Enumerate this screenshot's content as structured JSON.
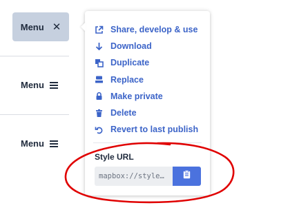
{
  "left_menus": [
    {
      "label": "Menu",
      "state": "open",
      "toggle_icon": "close-icon"
    },
    {
      "label": "Menu",
      "state": "closed",
      "toggle_icon": "hamburger-icon"
    },
    {
      "label": "Menu",
      "state": "closed",
      "toggle_icon": "hamburger-icon"
    }
  ],
  "dropdown": {
    "items": [
      {
        "label": "Share, develop & use",
        "icon": "external-link-icon"
      },
      {
        "label": "Download",
        "icon": "download-arrow-icon"
      },
      {
        "label": "Duplicate",
        "icon": "duplicate-icon"
      },
      {
        "label": "Replace",
        "icon": "replace-icon"
      },
      {
        "label": "Make private",
        "icon": "lock-icon"
      },
      {
        "label": "Delete",
        "icon": "trash-icon"
      },
      {
        "label": "Revert to last publish",
        "icon": "revert-icon"
      }
    ],
    "style_url": {
      "label": "Style URL",
      "value": "mapbox://style…",
      "copy_icon": "clipboard-icon"
    }
  },
  "colors": {
    "accent": "#3c64c8",
    "button_active_bg": "#c6d0df",
    "copy_button_bg": "#4b72de",
    "annotation": "#e00000"
  }
}
